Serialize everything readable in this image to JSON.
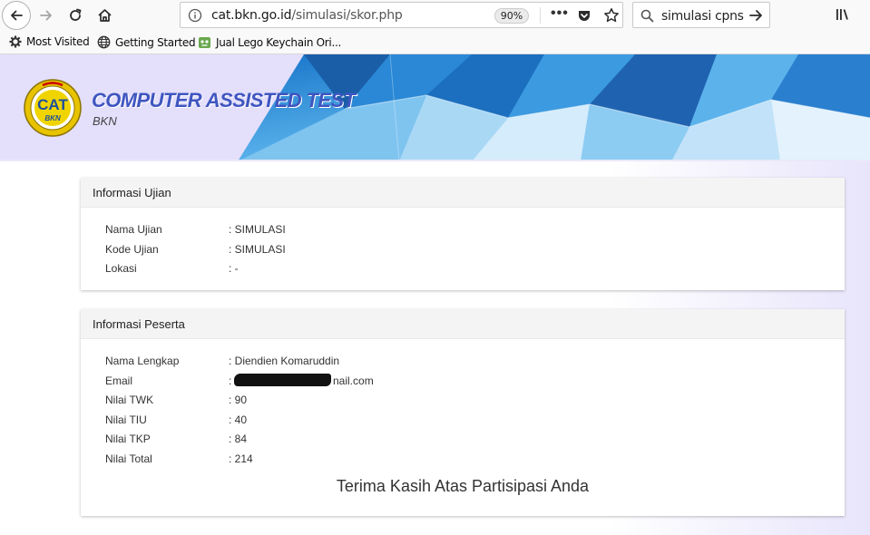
{
  "browser": {
    "url_prefix": "",
    "url_domain": "cat.bkn.go.id",
    "url_path": "/simulasi/skor.php",
    "zoom": "90%",
    "search_query": "simulasi cpns",
    "icons": [
      "back-icon",
      "forward-icon",
      "reload-icon",
      "home-icon",
      "info-icon",
      "more-icon",
      "pocket-icon",
      "bookmark-star-icon",
      "search-icon",
      "arrow-right-icon",
      "library-icon"
    ]
  },
  "bookmarks": [
    {
      "label": "Most Visited",
      "icon": "gear-icon"
    },
    {
      "label": "Getting Started",
      "icon": "globe-icon"
    },
    {
      "label": "Jual Lego Keychain Ori...",
      "icon": "favicon"
    }
  ],
  "header": {
    "title": "COMPUTER ASSISTED TEST",
    "subtitle": "BKN",
    "logo_text": "CAT",
    "logo_subtext": "BKN",
    "brand_color": "#3f56c0"
  },
  "exam_info": {
    "heading": "Informasi Ujian",
    "rows": [
      {
        "label": "Nama Ujian",
        "value": ": SIMULASI"
      },
      {
        "label": "Kode Ujian",
        "value": ": SIMULASI"
      },
      {
        "label": "Lokasi",
        "value": ": -"
      }
    ]
  },
  "participant_info": {
    "heading": "Informasi Peserta",
    "name_label": "Nama Lengkap",
    "name_value": ": Diendien Komaruddin",
    "email_label": "Email",
    "email_visible_prefix": ":",
    "email_visible_tail": "nail.com",
    "scores": [
      {
        "label": "Nilai TWK",
        "value": ": 90"
      },
      {
        "label": "Nilai TIU",
        "value": ": 40"
      },
      {
        "label": "Nilai TKP",
        "value": ": 84"
      },
      {
        "label": "Nilai Total",
        "value": ": 214"
      }
    ],
    "thanks": "Terima Kasih Atas Partisipasi Anda"
  }
}
